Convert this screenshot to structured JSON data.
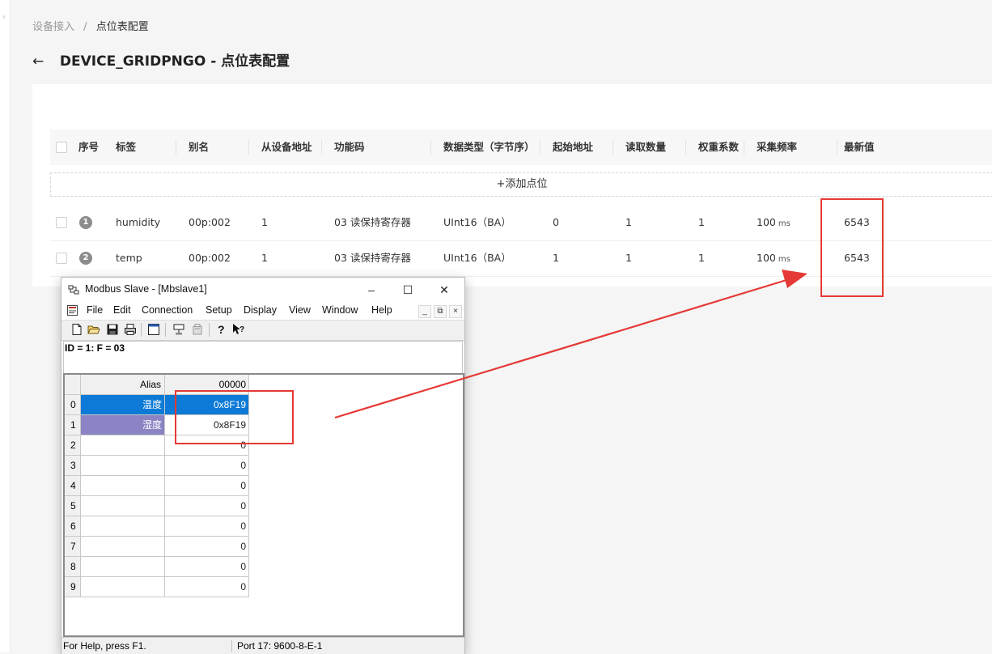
{
  "breadcrumb": {
    "root": "设备接入",
    "sep": "/",
    "current": "点位表配置"
  },
  "page": {
    "title": "DEVICE_GRIDPNGO - 点位表配置"
  },
  "table": {
    "headers": [
      "序号",
      "标签",
      "别名",
      "从设备地址",
      "功能码",
      "数据类型（字节序）",
      "起始地址",
      "读取数量",
      "权重系数",
      "采集频率",
      "最新值"
    ],
    "add_label": "+添加点位",
    "rows": [
      {
        "index": "1",
        "tag": "humidity",
        "alias": "00p:002",
        "slave": "1",
        "func": "03 读保持寄存器",
        "dtype": "UInt16（BA）",
        "start": "0",
        "count": "1",
        "weight": "1",
        "freq": "100",
        "freq_unit": "ms",
        "latest": "6543"
      },
      {
        "index": "2",
        "tag": "temp",
        "alias": "00p:002",
        "slave": "1",
        "func": "03 读保持寄存器",
        "dtype": "UInt16（BA）",
        "start": "1",
        "count": "1",
        "weight": "1",
        "freq": "100",
        "freq_unit": "ms",
        "latest": "6543"
      }
    ]
  },
  "modbus": {
    "title": "Modbus Slave - [Mbslave1]",
    "menu": [
      "File",
      "Edit",
      "Connection",
      "Setup",
      "Display",
      "View",
      "Window",
      "Help"
    ],
    "id_line": "ID = 1: F = 03",
    "grid": {
      "alias_header": "Alias",
      "value_header": "00000",
      "rows": [
        {
          "n": "0",
          "alias": "温度",
          "value": "0x8F19"
        },
        {
          "n": "1",
          "alias": "湿度",
          "value": "0x8F19"
        },
        {
          "n": "2",
          "alias": "",
          "value": "0"
        },
        {
          "n": "3",
          "alias": "",
          "value": "0"
        },
        {
          "n": "4",
          "alias": "",
          "value": "0"
        },
        {
          "n": "5",
          "alias": "",
          "value": "0"
        },
        {
          "n": "6",
          "alias": "",
          "value": "0"
        },
        {
          "n": "7",
          "alias": "",
          "value": "0"
        },
        {
          "n": "8",
          "alias": "",
          "value": "0"
        },
        {
          "n": "9",
          "alias": "",
          "value": "0"
        }
      ]
    },
    "status_left": "For Help, press F1.",
    "status_right": "Port 17: 9600-8-E-1"
  },
  "colors": {
    "highlight": "#e53935",
    "selection_blue": "#0c7ad6",
    "selection_purple": "#8a84c4"
  }
}
